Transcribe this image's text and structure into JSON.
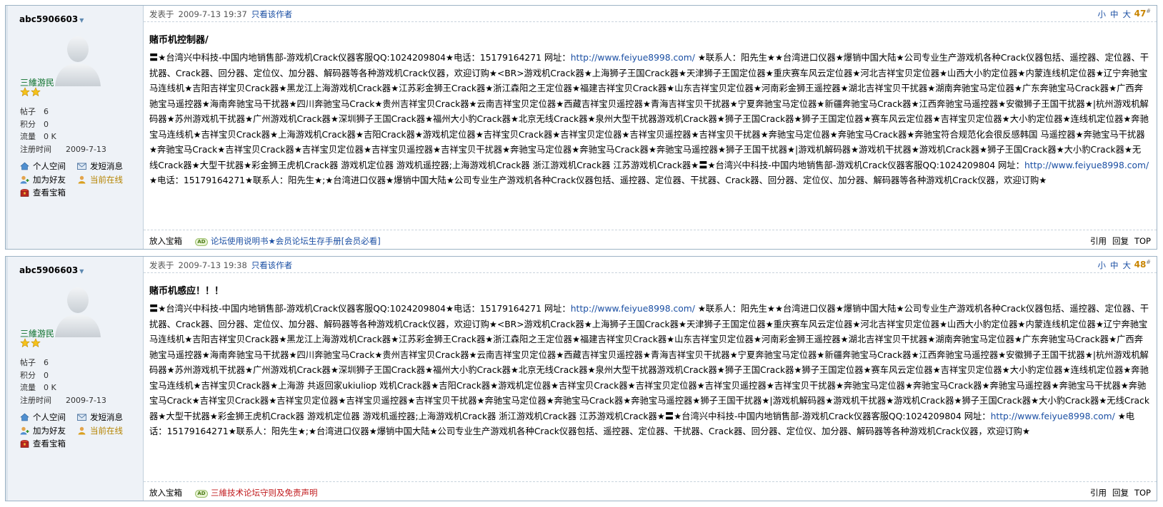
{
  "posts": [
    {
      "user": {
        "name": "abc5906603",
        "group": "三維游民",
        "stats": [
          {
            "label": "帖子",
            "value": "6"
          },
          {
            "label": "积分",
            "value": "0"
          },
          {
            "label": "流量",
            "value": "0 K"
          }
        ],
        "reg_label": "注册时间",
        "reg_value": "2009-7-13",
        "actions": {
          "space": "个人空间",
          "pm": "发短消息",
          "friend": "加为好友",
          "online": "当前在线",
          "treasure": "查看宝箱"
        }
      },
      "meta": {
        "posted_label": "发表于",
        "date": "2009-7-13 19:37",
        "author_only": "只看该作者"
      },
      "sizes": {
        "small": "小",
        "medium": "中",
        "large": "大"
      },
      "floor": "47",
      "title": "赌币机控制器/",
      "content_1": "〓★台湾兴中科技-中国内地销售部-游戏机Crack仪器客服QQ:1024209804★电话：15179164271 网址：",
      "url": "http://www.feiyue8998.com/",
      "content_2": " ★联系人：阳先生★★台湾进口仪器★爆销中国大陆★公司专业生产游戏机各种Crack仪器包括、遥控器、定位器、干扰器、Crack器、回分器、定位仪、加分器、解码器等各种游戏机Crack仪器，欢迎订购★<BR>游戏机Crack器★上海狮子王国Crack器★天津狮子王国定位器★重庆赛车风云定位器★河北吉祥宝贝定位器★山西大小豹定位器★内蒙连线机定位器★辽宁奔驰宝马连线机★吉阳吉祥宝贝Crack器★黑龙江上海游戏机Crack器★江苏彩金狮王Crack器★浙江森阳之王定位器★福建吉祥宝贝Crack器★山东吉祥宝贝定位器★河南彩金狮王遥控器★湖北吉祥宝贝干扰器★湖南奔驰宝马定位器★广东奔驰宝马Crack器★广西奔驰宝马遥控器★海南奔驰宝马干扰器★四川奔驰宝马Crack★贵州吉祥宝贝Crack器★云南吉祥宝贝定位器★西藏吉祥宝贝遥控器★青海吉祥宝贝干扰器★宁夏奔驰宝马定位器★新疆奔驰宝马Crack器★江西奔驰宝马遥控器★安徽狮子王国干扰器★|杭州游戏机解码器★苏州游戏机干扰器★广州游戏机Crack器★深圳狮子王国Crack器★福州大小豹Crack器★北京无线Crack器★泉州大型干扰器游戏机Crack器★狮子王国Crack器★狮子王国定位器★赛车风云定位器★吉祥宝贝定位器★大小豹定位器★连线机定位器★奔驰宝马连线机★吉祥宝贝Crack器★上海游戏机Crack器★吉阳Crack器★游戏机定位器★吉祥宝贝Crack器★吉祥宝贝定位器★吉祥宝贝遥控器★吉祥宝贝干扰器★奔驰宝马定位器★奔驰宝马Crack器★奔驰宝符合规范化会很反感韩国 马遥控器★奔驰宝马干扰器★奔驰宝马Crack★吉祥宝贝Crack器★吉祥宝贝定位器★吉祥宝贝遥控器★吉祥宝贝干扰器★奔驰宝马定位器★奔驰宝马Crack器★奔驰宝马遥控器★狮子王国干扰器★|游戏机解码器★游戏机干扰器★游戏机Crack器★狮子王国Crack器★大小豹Crack器★无线Crack器★大型干扰器★彩金狮王虎机Crack器 游戏机定位器 游戏机遥控器;上海游戏机Crack器 浙江游戏机Crack器 江苏游戏机Crack器★〓★台湾兴中科技-中国内地销售部-游戏机Crack仪器客服QQ:1024209804 网址：",
      "content_3": " ★电话：15179164271★联系人：阳先生★;★台湾进口仪器★爆销中国大陆★公司专业生产游戏机各种Crack仪器包括、遥控器、定位器、干扰器、Crack器、回分器、定位仪、加分器、解码器等各种游戏机Crack仪器，欢迎订购★",
      "footer": {
        "favorite": "放入宝箱",
        "ad_badge": "AD",
        "ad_text": "论坛使用说明书★会员论坛生存手册[会员必看]",
        "reply_quote": "引用",
        "reply": "回复",
        "top": "TOP"
      }
    },
    {
      "user": {
        "name": "abc5906603",
        "group": "三維游民",
        "stats": [
          {
            "label": "帖子",
            "value": "6"
          },
          {
            "label": "积分",
            "value": "0"
          },
          {
            "label": "流量",
            "value": "0 K"
          }
        ],
        "reg_label": "注册时间",
        "reg_value": "2009-7-13",
        "actions": {
          "space": "个人空间",
          "pm": "发短消息",
          "friend": "加为好友",
          "online": "当前在线",
          "treasure": "查看宝箱"
        }
      },
      "meta": {
        "posted_label": "发表于",
        "date": "2009-7-13 19:38",
        "author_only": "只看该作者"
      },
      "sizes": {
        "small": "小",
        "medium": "中",
        "large": "大"
      },
      "floor": "48",
      "title": "赌币机感应！！！",
      "content_1": "〓★台湾兴中科技-中国内地销售部-游戏机Crack仪器客服QQ:1024209804★电话：15179164271 网址：",
      "url": "http://www.feiyue8998.com/",
      "content_2": " ★联系人：阳先生★★台湾进口仪器★爆销中国大陆★公司专业生产游戏机各种Crack仪器包括、遥控器、定位器、干扰器、Crack器、回分器、定位仪、加分器、解码器等各种游戏机Crack仪器，欢迎订购★<BR>游戏机Crack器★上海狮子王国Crack器★天津狮子王国定位器★重庆赛车风云定位器★河北吉祥宝贝定位器★山西大小豹定位器★内蒙连线机定位器★辽宁奔驰宝马连线机★吉阳吉祥宝贝Crack器★黑龙江上海游戏机Crack器★江苏彩金狮王Crack器★浙江森阳之王定位器★福建吉祥宝贝Crack器★山东吉祥宝贝定位器★河南彩金狮王遥控器★湖北吉祥宝贝干扰器★湖南奔驰宝马定位器★广东奔驰宝马Crack器★广西奔驰宝马遥控器★海南奔驰宝马干扰器★四川奔驰宝马Crack★贵州吉祥宝贝Crack器★云南吉祥宝贝定位器★西藏吉祥宝贝遥控器★青海吉祥宝贝干扰器★宁夏奔驰宝马定位器★新疆奔驰宝马Crack器★江西奔驰宝马遥控器★安徽狮子王国干扰器★|杭州游戏机解码器★苏州游戏机干扰器★广州游戏机Crack器★深圳狮子王国Crack器★福州大小豹Crack器★北京无线Crack器★泉州大型干扰器游戏机Crack器★狮子王国Crack器★狮子王国定位器★赛车风云定位器★吉祥宝贝定位器★大小豹定位器★连线机定位器★奔驰宝马连线机★吉祥宝贝Crack器★上海游 共返回家ukiuliop 戏机Crack器★吉阳Crack器★游戏机定位器★吉祥宝贝Crack器★吉祥宝贝定位器★吉祥宝贝遥控器★吉祥宝贝干扰器★奔驰宝马定位器★奔驰宝马Crack器★奔驰宝马遥控器★奔驰宝马干扰器★奔驰宝马Crack★吉祥宝贝Crack器★吉祥宝贝定位器★吉祥宝贝遥控器★吉祥宝贝干扰器★奔驰宝马定位器★奔驰宝马Crack器★奔驰宝马遥控器★狮子王国干扰器★|游戏机解码器★游戏机干扰器★游戏机Crack器★狮子王国Crack器★大小豹Crack器★无线Crack器★大型干扰器★彩金狮王虎机Crack器 游戏机定位器 游戏机遥控器;上海游戏机Crack器 浙江游戏机Crack器 江苏游戏机Crack器★〓★台湾兴中科技-中国内地销售部-游戏机Crack仪器客服QQ:1024209804 网址：",
      "content_3": " ★电话：15179164271★联系人：阳先生★;★台湾进口仪器★爆销中国大陆★公司专业生产游戏机各种Crack仪器包括、遥控器、定位器、干扰器、Crack器、回分器、定位仪、加分器、解码器等各种游戏机Crack仪器，欢迎订购★",
      "footer": {
        "favorite": "放入宝箱",
        "ad_badge": "AD",
        "ad_text": "三維技术论坛守则及免责声明",
        "reply_quote": "引用",
        "reply": "回复",
        "top": "TOP"
      }
    }
  ],
  "colors": {
    "link": "#1b4fa3",
    "floor": "#c98500",
    "group": "#0a6f2a",
    "online": "#b58400",
    "ad_red": "#c0181b",
    "border": "#9db3c5"
  }
}
